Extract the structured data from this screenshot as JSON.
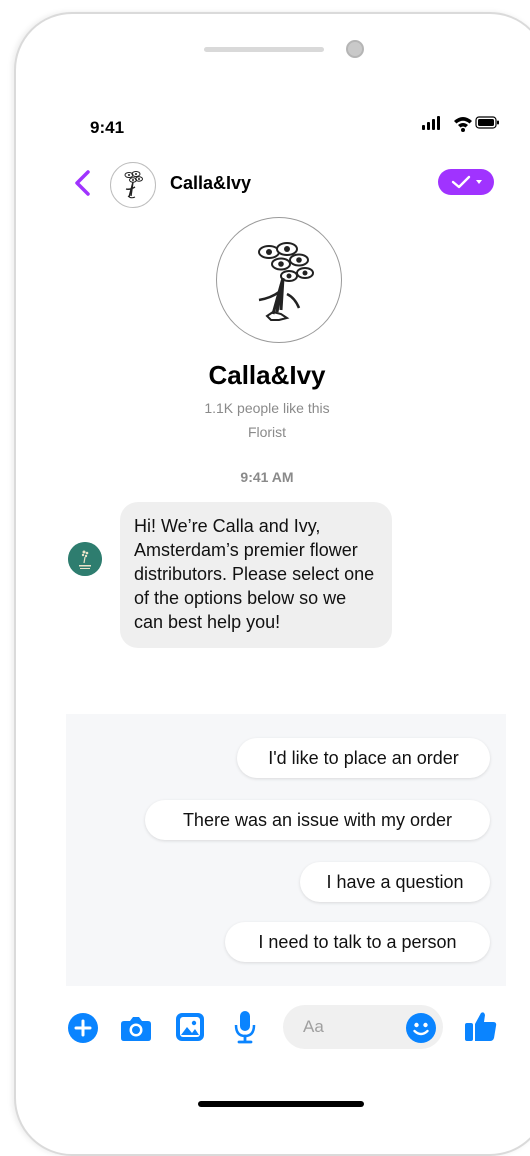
{
  "status_bar": {
    "time": "9:41"
  },
  "header": {
    "page_name": "Calla&Ivy"
  },
  "profile": {
    "name": "Calla&Ivy",
    "likes": "1.1K people like this",
    "category": "Florist"
  },
  "conversation": {
    "timestamp": "9:41 AM",
    "messages": [
      {
        "sender": "page",
        "text": "Hi! We’re Calla and Ivy, Amsterdam’s premier flower distributors. Please select one of the options below so we can best help you!"
      }
    ]
  },
  "quick_replies": [
    "I'd like to place an order",
    "There was an issue with my order",
    "I have a question",
    "I need to talk to a person"
  ],
  "composer": {
    "placeholder": "Aa",
    "icons": [
      "plus-icon",
      "camera-icon",
      "photo-icon",
      "microphone-icon",
      "emoji-icon",
      "thumbs-up-icon"
    ]
  },
  "colors": {
    "accent_purple": "#a033ff",
    "messenger_blue": "#0a84ff",
    "bubble_gray": "#efefef",
    "avatar_teal": "#2e7d6f"
  }
}
